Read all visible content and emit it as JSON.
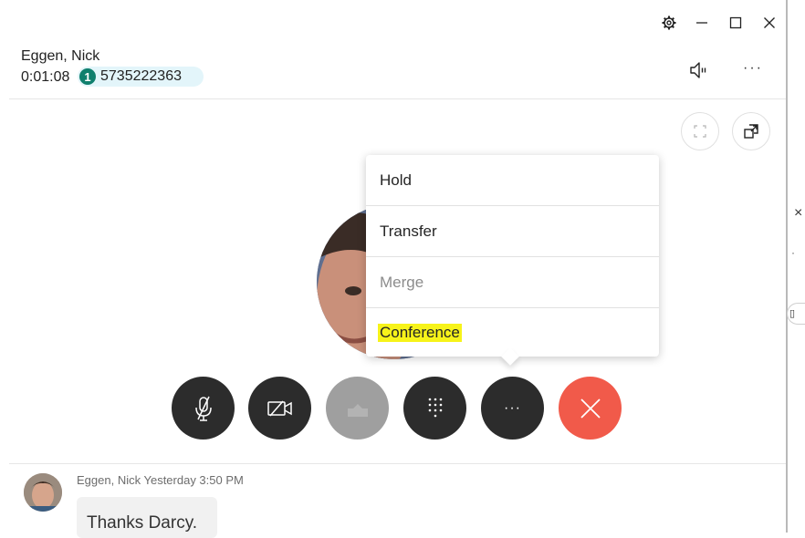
{
  "window": {
    "controls": {
      "settings": "settings-icon",
      "minimize": "minimize-icon",
      "maximize": "maximize-icon",
      "close": "close-icon"
    }
  },
  "call": {
    "caller_name": "Eggen, Nick",
    "duration": "0:01:08",
    "line_number": "1",
    "phone_number": "5735222363"
  },
  "header_actions": {
    "speaker": "speaker-icon",
    "more": "···"
  },
  "view_buttons": {
    "fullscreen": "fullscreen-icon",
    "popout": "popout-icon"
  },
  "menu": {
    "items": [
      {
        "label": "Hold",
        "enabled": true
      },
      {
        "label": "Transfer",
        "enabled": true
      },
      {
        "label": "Merge",
        "enabled": false
      },
      {
        "label": "Conference",
        "enabled": true,
        "highlighted": true
      }
    ]
  },
  "controls": {
    "mute": "microphone-off-icon",
    "video": "video-off-icon",
    "share": "share-icon",
    "keypad": "keypad-icon",
    "more": "···",
    "end": "end-call-icon"
  },
  "colors": {
    "dark_button": "#2c2c2c",
    "disabled_button": "#9f9f9f",
    "end_call": "#f15a4a",
    "line_badge": "#0f7f6d",
    "number_pill": "#e3f5fa",
    "highlight": "#f7f31a"
  },
  "chat": {
    "sender": "Eggen, Nick",
    "time": "Yesterday 3:50 PM",
    "message": "Thanks Darcy."
  }
}
